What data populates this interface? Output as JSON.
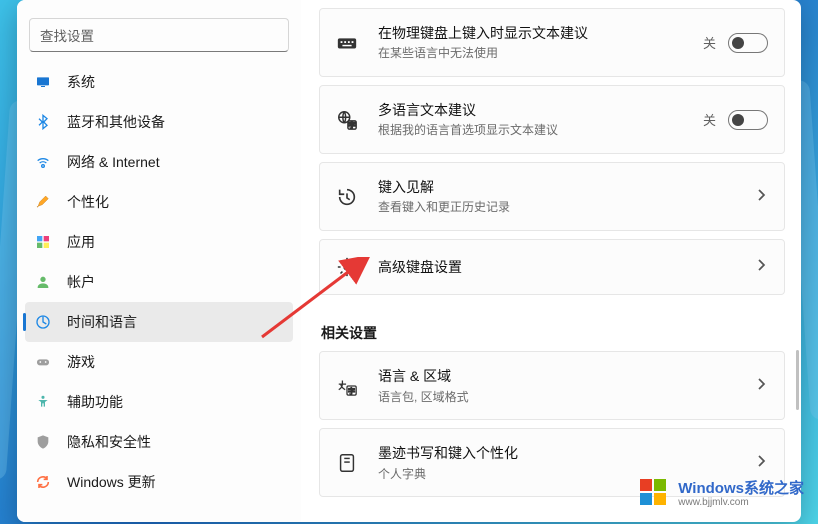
{
  "search": {
    "placeholder": "查找设置"
  },
  "sidebar": {
    "items": [
      {
        "label": "系统"
      },
      {
        "label": "蓝牙和其他设备"
      },
      {
        "label": "网络 & Internet"
      },
      {
        "label": "个性化"
      },
      {
        "label": "应用"
      },
      {
        "label": "帐户"
      },
      {
        "label": "时间和语言"
      },
      {
        "label": "游戏"
      },
      {
        "label": "辅助功能"
      },
      {
        "label": "隐私和安全性"
      },
      {
        "label": "Windows 更新"
      }
    ],
    "active_index": 6
  },
  "settings": {
    "physical_keyboard": {
      "title": "在物理键盘上键入时显示文本建议",
      "sub": "在某些语言中无法使用",
      "state_label": "关"
    },
    "multilingual": {
      "title": "多语言文本建议",
      "sub": "根据我的语言首选项显示文本建议",
      "state_label": "关"
    },
    "typing_insights": {
      "title": "键入见解",
      "sub": "查看键入和更正历史记录"
    },
    "advanced_keyboard": {
      "title": "高级键盘设置"
    },
    "section_related": "相关设置",
    "language_region": {
      "title": "语言 & 区域",
      "sub": "语言包, 区域格式"
    },
    "inking": {
      "title": "墨迹书写和键入个性化",
      "sub": "个人字典"
    }
  },
  "watermark": {
    "brand": "Windows",
    "suffix": "系统之家",
    "url": "www.bjjmlv.com"
  }
}
